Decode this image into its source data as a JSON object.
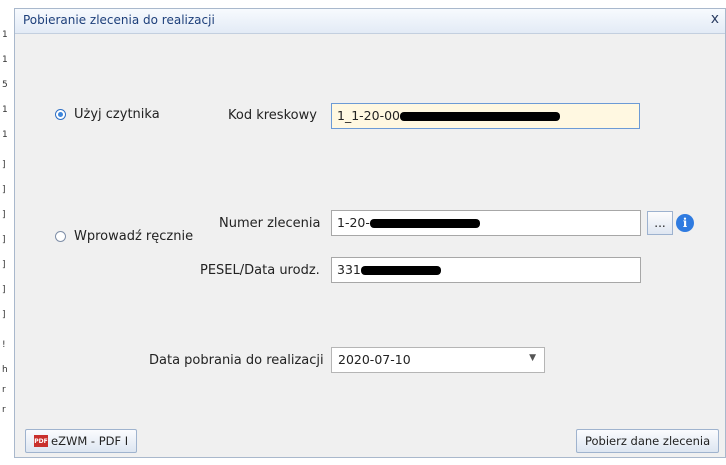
{
  "dialog": {
    "title": "Pobieranie zlecenia do realizacji",
    "close_label": "x"
  },
  "reader": {
    "radio_label": "Użyj czytnika",
    "barcode_label": "Kod kreskowy",
    "barcode_value": "1_1-20-00"
  },
  "manual": {
    "radio_label": "Wprowadź ręcznie",
    "order_label": "Numer zlecenia",
    "order_value": "1-20-",
    "browse_label": "...",
    "info_label": "i",
    "pesel_label": "PESEL/Data urodz.",
    "pesel_value": "331"
  },
  "date": {
    "label": "Data pobrania do realizacji",
    "value": "2020-07-10"
  },
  "footer": {
    "pdf_button": "eZWM - PDF I",
    "pdf_icon_text": "PDF",
    "fetch_button": "Pobierz dane zlecenia"
  },
  "background": {
    "strip_chars": [
      "1",
      "1",
      "5",
      "1",
      "1",
      "]",
      "]",
      "]",
      "]",
      "]",
      "]",
      "]",
      "!",
      "h",
      "r",
      "r"
    ]
  }
}
